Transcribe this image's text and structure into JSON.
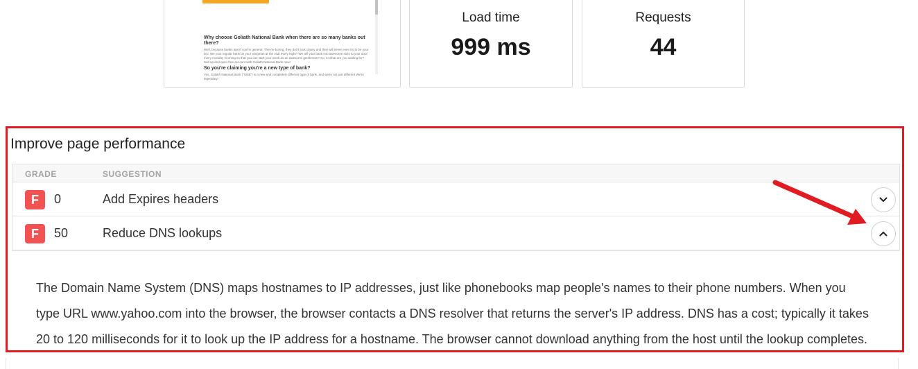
{
  "preview": {
    "heading1": "Why choose Goliath National Bank when there are so many banks out there?",
    "para1": "Well, because banks aren't cool in general. They're boring, they don't look classy and they will never even try to be your bro. We your regular bank be your wingman at the club every night? We tell your bank into awesome suits to your door every monday morning so that you can start your week as an awesome gentleman? So, to what are you waiting for? Suit up and open free account with Goliath National Bank now!",
    "heading2": "So you're claiming you're a new type of bank?",
    "para2": "Yes, Goliath National Bank (\"GNB\") is a new and completely different type of bank, and we're not just different We're legendary!"
  },
  "metrics": {
    "load_time": {
      "label": "Load time",
      "value": "999 ms"
    },
    "requests": {
      "label": "Requests",
      "value": "44"
    }
  },
  "improve": {
    "title": "Improve page performance",
    "columns": {
      "grade": "GRADE",
      "suggestion": "SUGGESTION"
    },
    "rows": [
      {
        "grade": "F",
        "score": "0",
        "suggestion": "Add Expires headers",
        "expanded": false,
        "toggle_icon": "chevron-down-icon"
      },
      {
        "grade": "F",
        "score": "50",
        "suggestion": "Reduce DNS lookups",
        "expanded": true,
        "toggle_icon": "chevron-up-icon"
      }
    ],
    "detail_text": "The Domain Name System (DNS) maps hostnames to IP addresses, just like phonebooks map people's names to their phone numbers. When you type URL www.yahoo.com into the browser, the browser contacts a DNS resolver that returns the server's IP address. DNS has a cost; typically it takes 20 to 120 milliseconds for it to look up the IP address for a hostname. The browser cannot download anything from the host until the lookup completes."
  },
  "colors": {
    "grade_f": "#f25252",
    "highlight_border": "#e11b22",
    "preview_button": "#f5a623"
  }
}
